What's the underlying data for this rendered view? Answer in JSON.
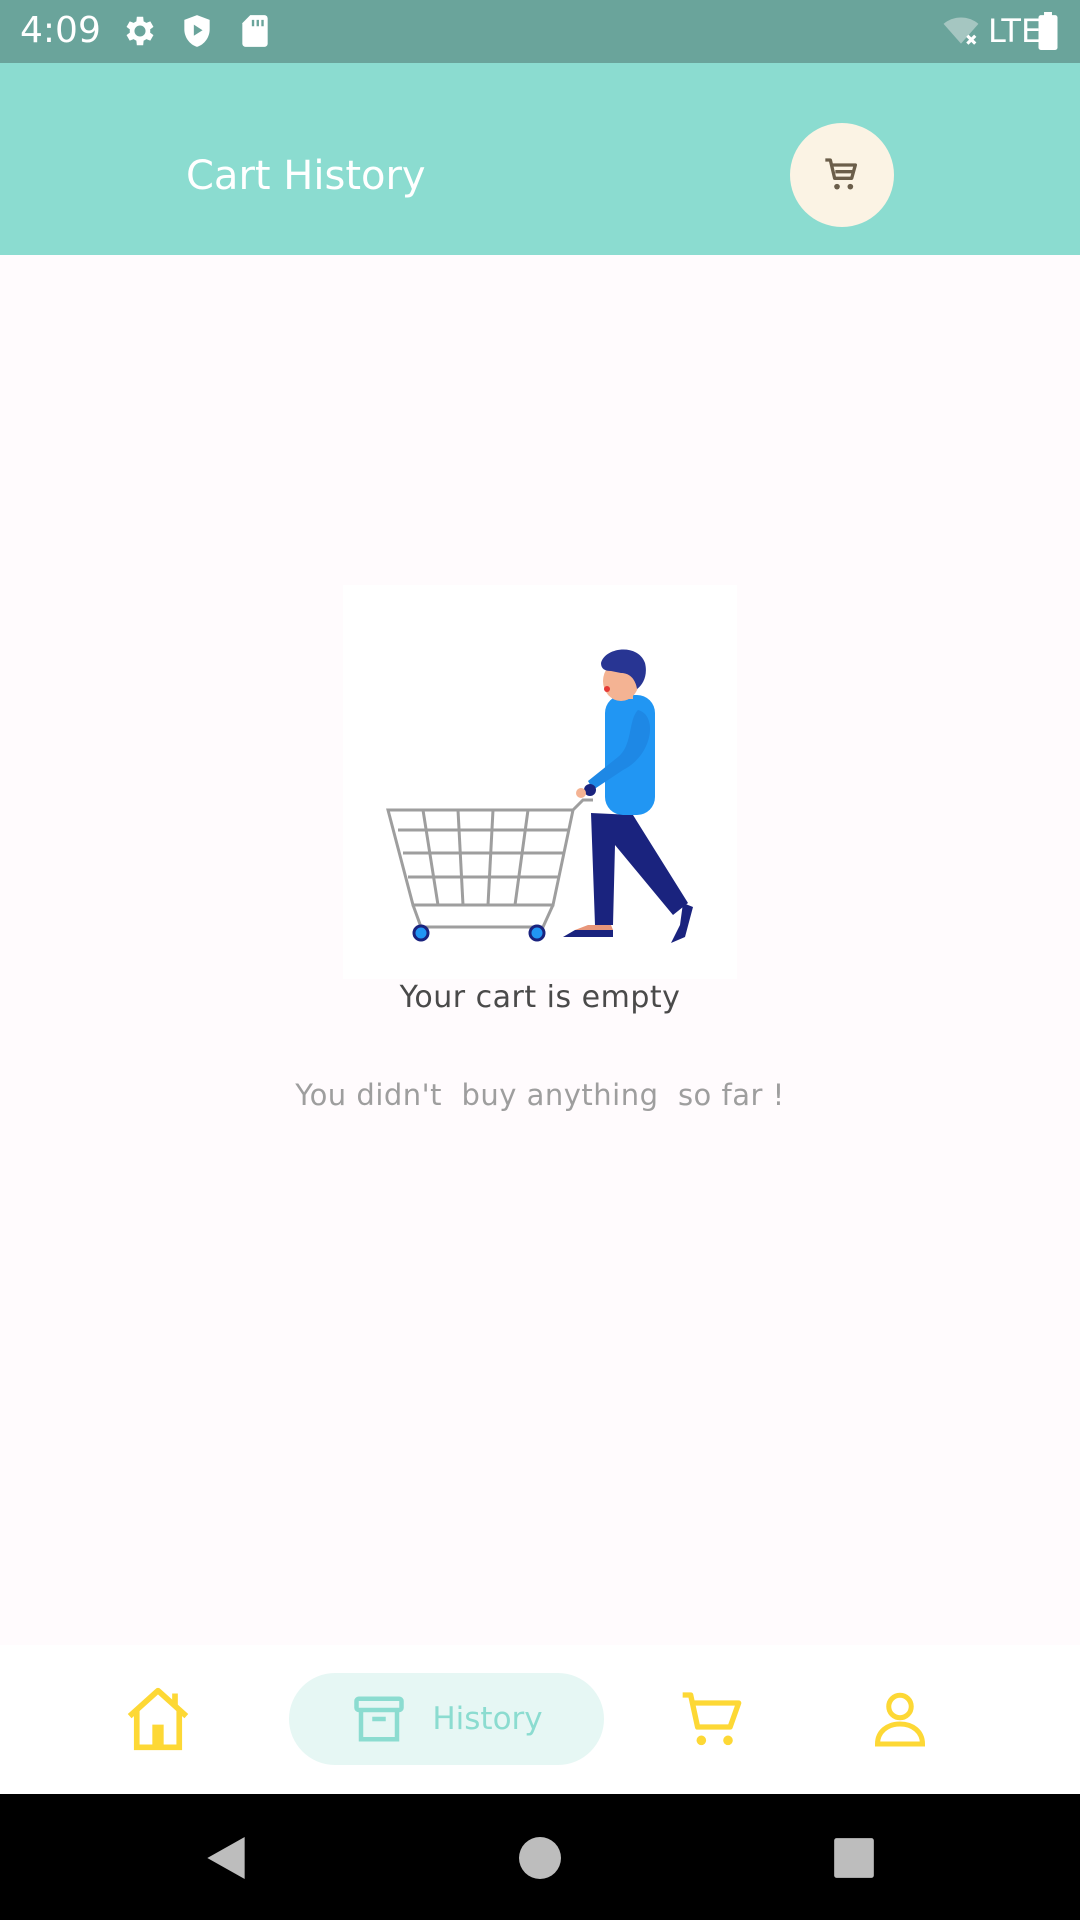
{
  "status_bar": {
    "time": "4:09",
    "network_label": "LTE",
    "icons": [
      "settings-icon",
      "play-protect-icon",
      "sd-card-icon",
      "wifi-off-icon",
      "battery-icon"
    ],
    "background": "#6aa49b"
  },
  "app_bar": {
    "title": "Cart History",
    "action_icon": "cart-icon",
    "background": "#8bdcd0"
  },
  "empty_state": {
    "illustration": "person-pushing-shopping-cart",
    "title": "Your cart is empty",
    "subtitle": "You didn't  buy anything  so far !"
  },
  "bottom_nav": {
    "items": [
      {
        "icon": "home-icon",
        "label": "",
        "selected": false
      },
      {
        "icon": "archive-box-icon",
        "label": "History",
        "selected": true
      },
      {
        "icon": "cart-icon",
        "label": "",
        "selected": false
      },
      {
        "icon": "person-icon",
        "label": "",
        "selected": false
      }
    ],
    "accent": "#fdd835",
    "selected_color": "#8bdcd0"
  },
  "system_nav": {
    "buttons": [
      "back-icon",
      "home-circle-icon",
      "recents-icon"
    ]
  }
}
